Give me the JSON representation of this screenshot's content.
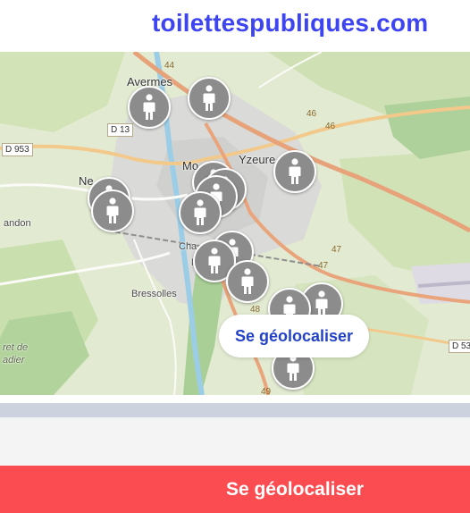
{
  "header": {
    "site_title": "toilettespubliques.com"
  },
  "map": {
    "place_labels": {
      "avermes": "Avermes",
      "yzeure": "Yzeure",
      "moulins_partial": "Mo",
      "neuvy_partial": "Ne",
      "bressolles": "Bressolles",
      "andon_partial": "andon",
      "chemilly_partial": "Cha",
      "n_partial": "N",
      "foret_de_partial": "ret de",
      "adier_partial": "adier"
    },
    "road_labels": {
      "d953": "D 953",
      "d13": "D 13",
      "d53_partial": "D 53",
      "r44": "44",
      "r46a": "46",
      "r46b": "46",
      "r47a": "47",
      "r47b": "47",
      "r48": "48",
      "r49": "49"
    },
    "marker_count": 15,
    "geolocate_bubble_label": "Se géolocaliser"
  },
  "footer": {
    "cta_label": "Se géolocaliser"
  },
  "colors": {
    "brand_blue": "#3d44f2",
    "cta_red": "#fb4c52",
    "marker_gray": "#8c8c8c",
    "bubble_text_blue": "#2442c8"
  }
}
